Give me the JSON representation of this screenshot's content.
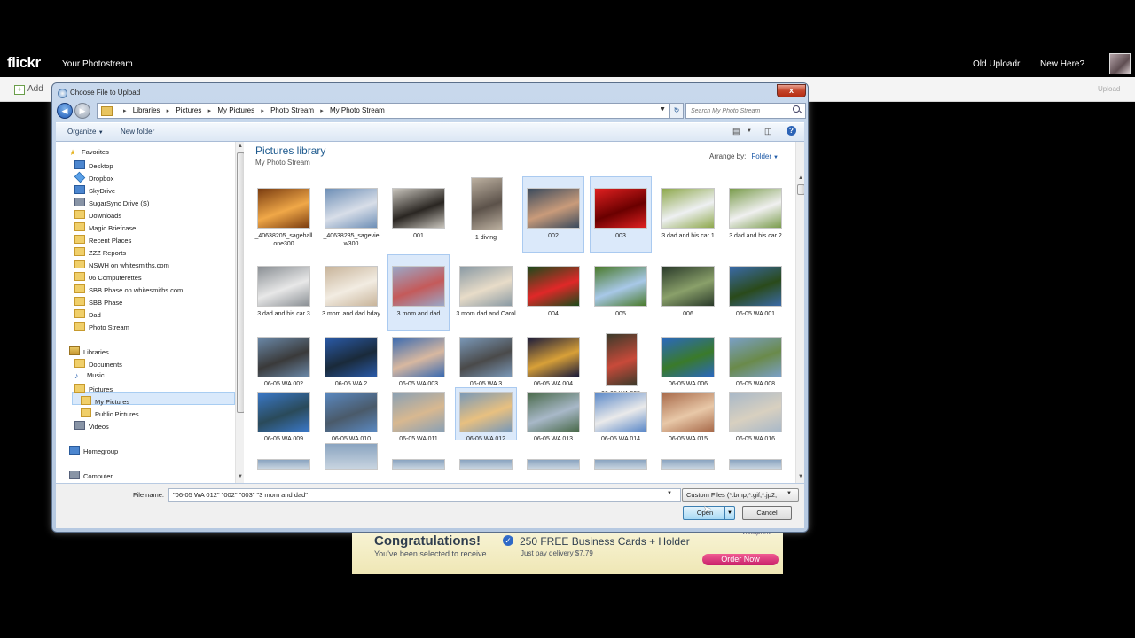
{
  "flickr": {
    "logo": "flickr",
    "nav_photostream": "Your Photostream",
    "nav_old_uploadr": "Old Uploadr",
    "nav_new_here": "New Here?",
    "toolbar_add": "Add",
    "toolbar_upload": "Upload"
  },
  "ad": {
    "title": "Congratulations!",
    "subtitle": "You've been selected to receive",
    "offer": "250 FREE Business Cards + Holder",
    "delivery": "Just pay delivery $7.79",
    "button": "Order Now",
    "brand": "vistaprint"
  },
  "dialog": {
    "title": "Choose File to Upload",
    "close": "x",
    "breadcrumbs": [
      "Libraries",
      "Pictures",
      "My Pictures",
      "Photo Stream",
      "My Photo Stream"
    ],
    "search_placeholder": "Search My Photo Stream",
    "organize": "Organize",
    "new_folder": "New folder",
    "library_title": "Pictures library",
    "library_subtitle": "My Photo Stream",
    "arrange_label": "Arrange by:",
    "arrange_value": "Folder",
    "file_name_label": "File name:",
    "file_name_value": "\"06-05 WA 012\" \"002\" \"003\" \"3 mom and dad\"",
    "filter_value": "Custom Files (*.bmp;*.gif;*.jp2;",
    "open_button": "Open",
    "cancel_button": "Cancel"
  },
  "nav_tree": {
    "favorites_header": "Favorites",
    "favorites": [
      "Desktop",
      "Dropbox",
      "SkyDrive",
      "SugarSync Drive (S)",
      "Downloads",
      "Magic Briefcase",
      "Recent Places",
      "ZZZ Reports",
      "NSWH on whitesmiths.com",
      "06 Computerettes",
      "SBB Phase on whitesmiths.com",
      "SBB Phase",
      "Dad",
      "Photo Stream"
    ],
    "libraries_header": "Libraries",
    "libraries": [
      "Documents",
      "Music",
      "Pictures",
      "My Pictures",
      "Public Pictures",
      "Videos"
    ],
    "homegroup": "Homegroup",
    "computer": "Computer"
  },
  "thumbnails": [
    "_40638205_sagehallone300",
    "_40638235_sageview300",
    "001",
    "1 diving",
    "002",
    "003",
    "3 dad and his car 1",
    "3 dad and his car 2",
    "3 dad and his car 3",
    "3 mom and dad bday",
    "3 mom and dad",
    "3 mom dad and Carol",
    "004",
    "005",
    "006",
    "06-05 WA 001",
    "06-05 WA 002",
    "06-05 WA 2",
    "06-05 WA 003",
    "06-05 WA 3",
    "06-05 WA 004",
    "06-05 WA 005",
    "06-05 WA 006",
    "06-05 WA 008",
    "06-05 WA 009",
    "06-05 WA 010",
    "06-05 WA 011",
    "06-05 WA 012",
    "06-05 WA 013",
    "06-05 WA 014",
    "06-05 WA 015",
    "06-05 WA 016"
  ],
  "selected_thumbnails": [
    "002",
    "003",
    "3 mom and dad",
    "06-05 WA 012"
  ]
}
